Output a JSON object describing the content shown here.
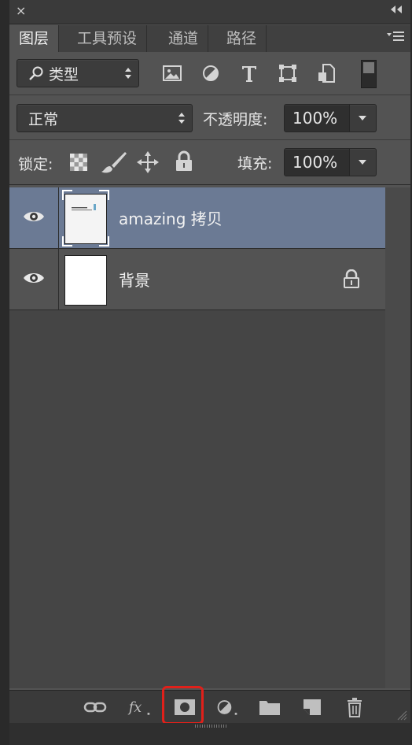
{
  "window": {
    "close_glyph": "×",
    "collapse_glyph": "◂◂"
  },
  "tabs": [
    {
      "label": "图层",
      "active": true
    },
    {
      "label": "工具预设",
      "active": false
    },
    {
      "label": "通道",
      "active": false
    },
    {
      "label": "路径",
      "active": false
    }
  ],
  "filter": {
    "type_label": "类型",
    "icons": [
      "image-filter-icon",
      "adjustment-filter-icon",
      "type-filter-icon",
      "shape-filter-icon",
      "smart-object-filter-icon"
    ]
  },
  "blend": {
    "mode": "正常",
    "opacity_label": "不透明度:",
    "opacity_value": "100%"
  },
  "lock": {
    "label": "锁定:",
    "fill_label": "填充:",
    "fill_value": "100%"
  },
  "layers": [
    {
      "name": "amazing 拷贝",
      "selected": true,
      "locked": false
    },
    {
      "name": "背景",
      "selected": false,
      "locked": true
    }
  ],
  "bottom_icons": [
    "link-layers-icon",
    "fx-icon",
    "add-mask-icon",
    "adjustment-layer-icon",
    "new-group-icon",
    "new-layer-icon",
    "delete-layer-icon"
  ],
  "colors": {
    "panel_bg": "#535353",
    "selected_row": "#6b7a94",
    "highlight": "#e0201a"
  }
}
